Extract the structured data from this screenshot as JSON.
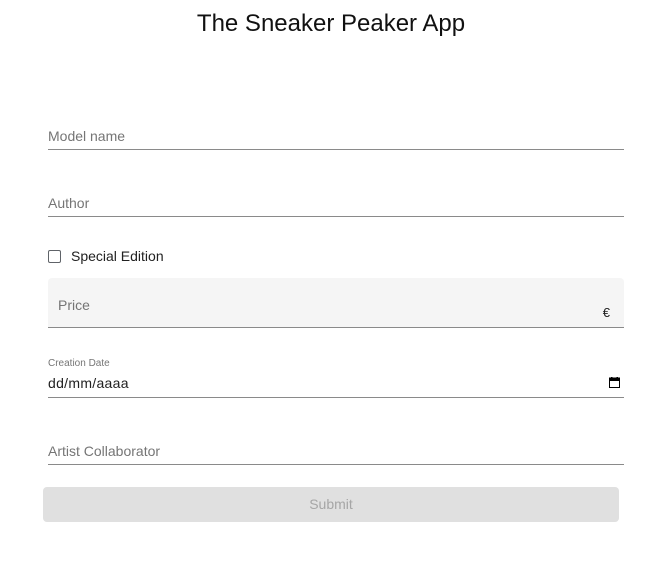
{
  "app": {
    "title": "The Sneaker Peaker App"
  },
  "form": {
    "model_name": {
      "placeholder": "Model name",
      "value": ""
    },
    "author": {
      "placeholder": "Author",
      "value": ""
    },
    "special_edition": {
      "label": "Special Edition",
      "checked": false
    },
    "price": {
      "placeholder": "Price",
      "suffix": "€",
      "value": ""
    },
    "creation_date": {
      "label": "Creation Date",
      "value": "dd/mm/aaaa",
      "icon": "calendar-icon"
    },
    "artist_collaborator": {
      "placeholder": "Artist Collaborator",
      "value": ""
    },
    "submit": {
      "label": "Submit",
      "disabled": true
    }
  }
}
